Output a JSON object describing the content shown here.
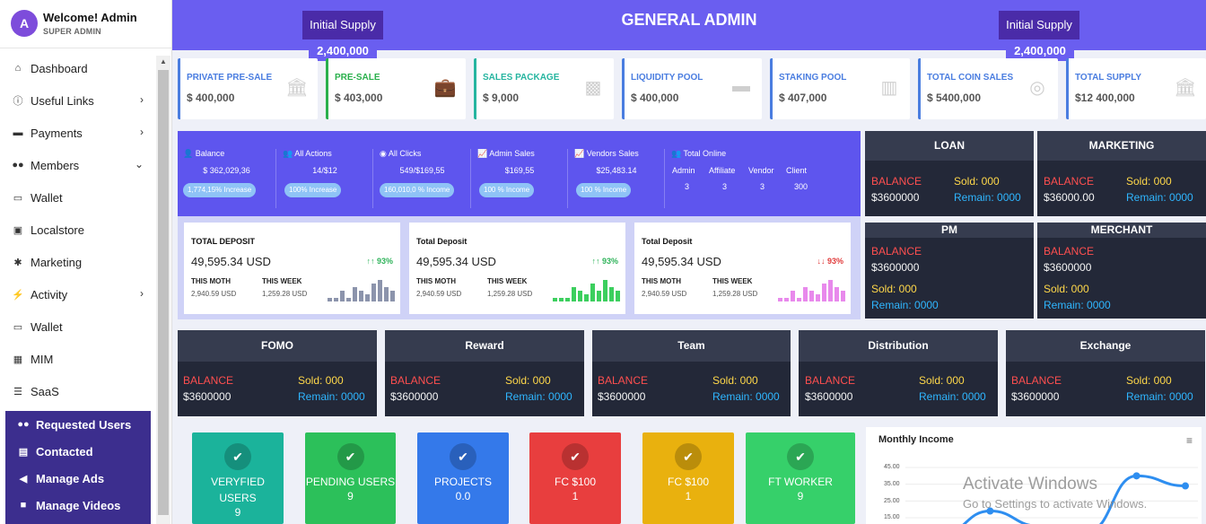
{
  "sidebar": {
    "avatar_letter": "A",
    "welcome": "Welcome! Admin",
    "role": "SUPER ADMIN",
    "items": [
      {
        "label": "Dashboard",
        "icon": "home-icon",
        "chevron": ""
      },
      {
        "label": "Useful Links",
        "icon": "info-icon",
        "chevron": "›"
      },
      {
        "label": "Payments",
        "icon": "credit-card-icon",
        "chevron": "›"
      },
      {
        "label": "Members",
        "icon": "users-icon",
        "chevron": "⌄"
      },
      {
        "label": "Wallet",
        "icon": "wallet-icon",
        "chevron": ""
      },
      {
        "label": "Localstore",
        "icon": "lock-icon",
        "chevron": ""
      },
      {
        "label": "Marketing",
        "icon": "gear-icon",
        "chevron": ""
      },
      {
        "label": "Activity",
        "icon": "running-icon",
        "chevron": "›"
      },
      {
        "label": "Wallet",
        "icon": "wallet-icon",
        "chevron": ""
      },
      {
        "label": "MIM",
        "icon": "calendar-icon",
        "chevron": ""
      },
      {
        "label": "SaaS",
        "icon": "list-icon",
        "chevron": ""
      }
    ],
    "sub_items": [
      {
        "label": "Requested Users",
        "icon": "users-icon"
      },
      {
        "label": "Contacted",
        "icon": "table-icon"
      },
      {
        "label": "Manage Ads",
        "icon": "megaphone-icon"
      },
      {
        "label": "Manage Videos",
        "icon": "video-icon"
      }
    ]
  },
  "header": {
    "title": "GENERAL ADMIN",
    "supply_left_label": "Initial Supply",
    "supply_left_value": "2,400,000",
    "supply_right_label": "Initial Supply",
    "supply_right_value": "2,400,000"
  },
  "stats": [
    {
      "label": "PRIVATE PRE-SALE",
      "value": "$ 400,000",
      "color": "#4a7de0"
    },
    {
      "label": "PRE-SALE",
      "value": "$ 403,000",
      "color": "#2ab04c"
    },
    {
      "label": "SALES PACKAGE",
      "value": "$ 9,000",
      "color": "#26b5a0"
    },
    {
      "label": "LIQUIDITY POOL",
      "value": "$ 400,000",
      "color": "#4a7de0"
    },
    {
      "label": "STAKING POOL",
      "value": "$ 407,000",
      "color": "#4a7de0"
    },
    {
      "label": "TOTAL COIN SALES",
      "value": "$ 5400,000",
      "color": "#4a7de0"
    },
    {
      "label": "TOTAL SUPPLY",
      "value": "$12 400,000",
      "color": "#4a7de0"
    }
  ],
  "metrics": [
    {
      "title": "Balance",
      "value": "$ 362,029,36",
      "pill": "1,774,15% Increase"
    },
    {
      "title": "All Actions",
      "value": "14/$12",
      "pill": "100% Increase"
    },
    {
      "title": "All Clicks",
      "value": "549/$169,55",
      "pill": "160,010,0 % Income"
    },
    {
      "title": "Admin Sales",
      "value": "$169,55",
      "pill": "100 % Income"
    },
    {
      "title": "Vendors Sales",
      "value": "$25,483.14",
      "pill": "100 % Income"
    }
  ],
  "online": {
    "title": "Total Online",
    "headers": [
      "Admin",
      "Affiliate",
      "Vendor",
      "Client"
    ],
    "values": [
      "3",
      "3",
      "3",
      "300"
    ]
  },
  "deposits": [
    {
      "title": "TOTAL DEPOSIT",
      "value": "49,595.34 USD",
      "change": "↑↑ 93%",
      "color": "#2fb35a",
      "bar_color": "#8c94ac",
      "month_label": "THIS MOTH",
      "month_value": "2,940.59 USD",
      "week_label": "THIS WEEK",
      "week_value": "1,259.28 USD",
      "bars": [
        1,
        1,
        3,
        1,
        4,
        3,
        2,
        5,
        6,
        4,
        3
      ]
    },
    {
      "title": "Total Deposit",
      "value": "49,595.34 USD",
      "change": "↑↑ 93%",
      "color": "#2fb35a",
      "bar_color": "#3ccf5e",
      "month_label": "THIS MOTH",
      "month_value": "2,940.59 USD",
      "week_label": "THIS WEEK",
      "week_value": "1,259.28 USD",
      "bars": [
        1,
        1,
        1,
        4,
        3,
        2,
        5,
        3,
        6,
        4,
        3
      ]
    },
    {
      "title": "Total Deposit",
      "value": "49,595.34 USD",
      "change": "↓↓ 93%",
      "color": "#e03b3b",
      "bar_color": "#e889ec",
      "month_label": "THIS MOTH",
      "month_value": "2,940.59 USD",
      "week_label": "THIS WEEK",
      "week_value": "1,259.28 USD",
      "bars": [
        1,
        1,
        3,
        1,
        4,
        3,
        2,
        5,
        6,
        4,
        3
      ]
    }
  ],
  "balance_cards": [
    {
      "title": "LOAN",
      "balance_label": "BALANCE",
      "balance": "$3600000",
      "sold": "Sold: 000",
      "remain": "Remain: 0000"
    },
    {
      "title": "MARKETING",
      "balance_label": "BALANCE",
      "balance": "$36000.00",
      "sold": "Sold: 000",
      "remain": "Remain: 0000"
    },
    {
      "title": "PM",
      "balance_label": "BALANCE",
      "balance": "$3600000",
      "sold": "Sold: 000",
      "remain": "Remain: 0000"
    },
    {
      "title": "MERCHANT",
      "balance_label": "BALANCE",
      "balance": "$3600000",
      "sold": "Sold: 000",
      "remain": "Remain: 0000"
    },
    {
      "title": "FOMO",
      "balance_label": "BALANCE",
      "balance": "$3600000",
      "sold": "Sold: 000",
      "remain": "Remain: 0000"
    },
    {
      "title": "Reward",
      "balance_label": "BALANCE",
      "balance": "$3600000",
      "sold": "Sold: 000",
      "remain": "Remain: 0000"
    },
    {
      "title": "Team",
      "balance_label": "BALANCE",
      "balance": "$3600000",
      "sold": "Sold: 000",
      "remain": "Remain: 0000"
    },
    {
      "title": "Distribution",
      "balance_label": "BALANCE",
      "balance": "$3600000",
      "sold": "Sold: 000",
      "remain": "Remain: 0000"
    },
    {
      "title": "Exchange",
      "balance_label": "BALANCE",
      "balance": "$3600000",
      "sold": "Sold: 000",
      "remain": "Remain: 0000"
    }
  ],
  "tiles": [
    {
      "label": "VERYFIED USERS",
      "value": "9",
      "color": "#1bb39b"
    },
    {
      "label": "PENDING USERS",
      "value": "9",
      "color": "#2cc05a"
    },
    {
      "label": "PROJECTS",
      "value": "0.0",
      "color": "#3479ea"
    },
    {
      "label": "FC $100",
      "value": "1",
      "color": "#e83e3e"
    },
    {
      "label": "FC $100",
      "value": "1",
      "color": "#e9b10e"
    },
    {
      "label": "FT WORKER",
      "value": "9",
      "color": "#36d06a"
    }
  ],
  "income_chart": {
    "title": "Monthly Income",
    "menu_icon": "hamburger-menu-icon",
    "chart_data": {
      "type": "line",
      "title": "Monthly Income",
      "ylim": [
        15,
        45
      ],
      "y_ticks": [
        "45.00",
        "35.00",
        "25.00",
        "15.00"
      ],
      "series": [
        {
          "values": [
            5,
            19,
            10,
            7,
            40,
            34
          ]
        }
      ],
      "color": "#2e8ef0"
    }
  },
  "watermark": {
    "line1": "Activate Windows",
    "line2": "Go to Settings to activate Windows."
  }
}
